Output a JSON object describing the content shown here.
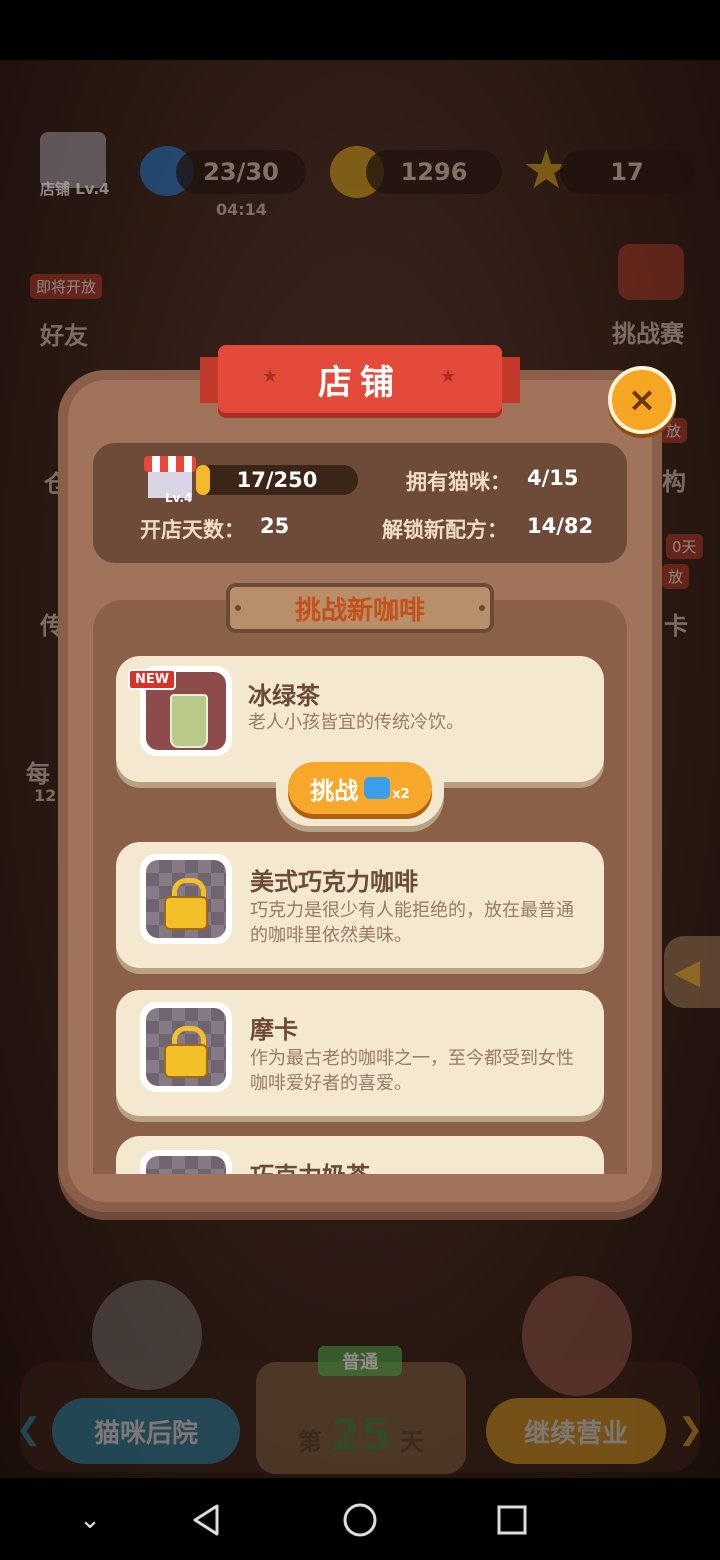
{
  "hud": {
    "shop_label": "店铺 Lv.4",
    "energy": "23/30",
    "energy_timer": "04:14",
    "coins": "1296",
    "stars": "17"
  },
  "side": {
    "friends_badge": "即将开放",
    "friends": "好友",
    "challenge": "挑战赛",
    "right_badge_1": "放",
    "right_text_1": "构",
    "right_badge_2": "0天",
    "right_badge_3": "放",
    "right_text_2": "卡",
    "left_text_1": "仓",
    "left_text_2": "传",
    "left_text_3": "每",
    "left_text_4": "12"
  },
  "modal": {
    "title": "店铺",
    "close": "×",
    "shop_level": "Lv.4",
    "exp": "17/250",
    "cats_label": "拥有猫咪：",
    "cats_value": "4/15",
    "days_label": "开店天数：",
    "days_value": "25",
    "recipes_label": "解锁新配方：",
    "recipes_value": "14/82",
    "section_title": "挑战新咖啡"
  },
  "recipes": [
    {
      "name": "冰绿茶",
      "desc": "老人小孩皆宜的传统冷饮。",
      "badge": "NEW",
      "locked": false
    },
    {
      "name": "美式巧克力咖啡",
      "desc": "巧克力是很少有人能拒绝的，放在最普通的咖啡里依然美味。",
      "locked": true
    },
    {
      "name": "摩卡",
      "desc": "作为最古老的咖啡之一，至今都受到女性咖啡爱好者的喜爱。",
      "locked": true
    },
    {
      "name": "巧克力奶茶",
      "desc": "",
      "locked": true
    }
  ],
  "challenge_button": {
    "label": "挑战",
    "cost": "x2"
  },
  "bottom": {
    "backyard": "猫咪后院",
    "mode": "普通",
    "day_prefix": "第",
    "day_number": "25",
    "day_suffix": "天",
    "continue": "继续营业"
  },
  "colors": {
    "ribbon": "#e44a3a",
    "card": "#f4e8d0",
    "accent": "#f7a72a"
  }
}
